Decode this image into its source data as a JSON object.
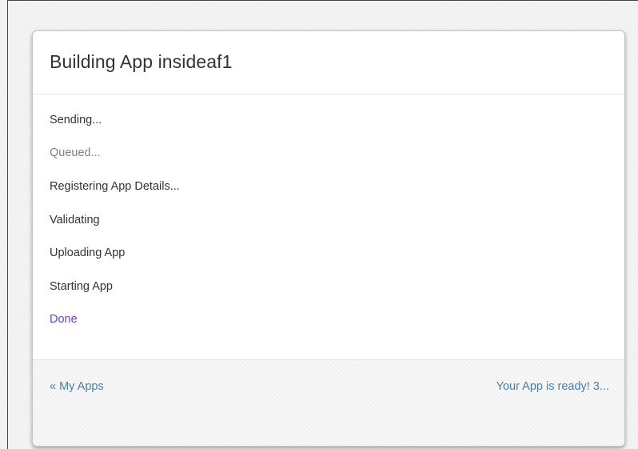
{
  "modal": {
    "title": "Building App insideaf1"
  },
  "steps": [
    {
      "label": "Sending...",
      "status": "active"
    },
    {
      "label": "Queued...",
      "status": "muted"
    },
    {
      "label": "Registering App Details...",
      "status": "active"
    },
    {
      "label": "Validating",
      "status": "active"
    },
    {
      "label": "Uploading App",
      "status": "active"
    },
    {
      "label": "Starting App",
      "status": "active"
    },
    {
      "label": "Done",
      "status": "done"
    }
  ],
  "footer": {
    "back_link": "« My Apps",
    "ready_text": "Your App is ready! 3..."
  },
  "colors": {
    "text": "#333333",
    "muted": "#808080",
    "done": "#6c3fd1",
    "link": "#4a7fa5"
  }
}
